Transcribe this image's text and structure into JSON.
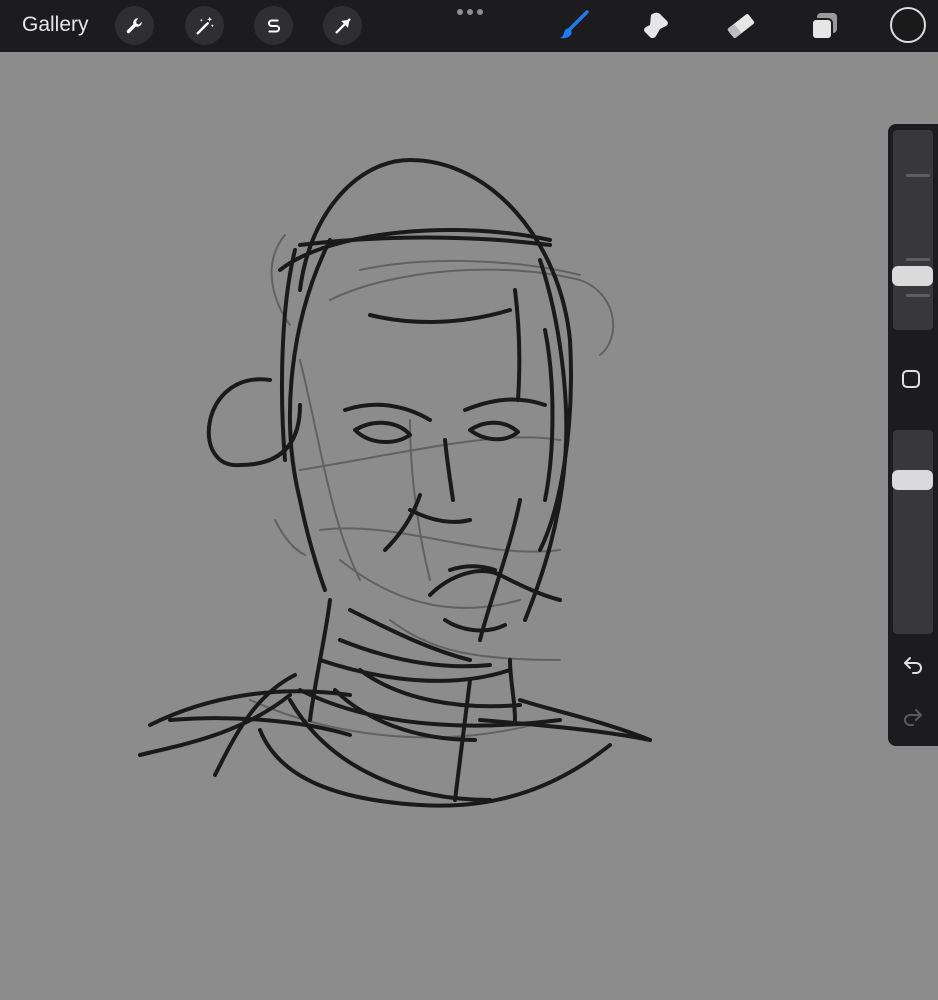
{
  "toolbar": {
    "gallery_label": "Gallery",
    "left_tools": [
      "wrench-icon",
      "magic-wand-icon",
      "selection-s-icon",
      "transform-arrow-icon"
    ],
    "right_tools": [
      "brush-icon",
      "smudge-icon",
      "eraser-icon",
      "layers-icon"
    ],
    "active_tool": "brush-icon",
    "active_color_hex": "#1a1a1a",
    "accent_color": "#1e7bf5"
  },
  "sidebar": {
    "brush_size_level": 0.62,
    "opacity_level": 0.88,
    "modify_button": "square-icon",
    "undo": "undo-arrow-icon",
    "redo": "redo-arrow-icon"
  },
  "canvas": {
    "background": "#8c8c8c",
    "stroke_color": "#1a1a1a",
    "content": "sketch-of-head-and-shoulders"
  }
}
